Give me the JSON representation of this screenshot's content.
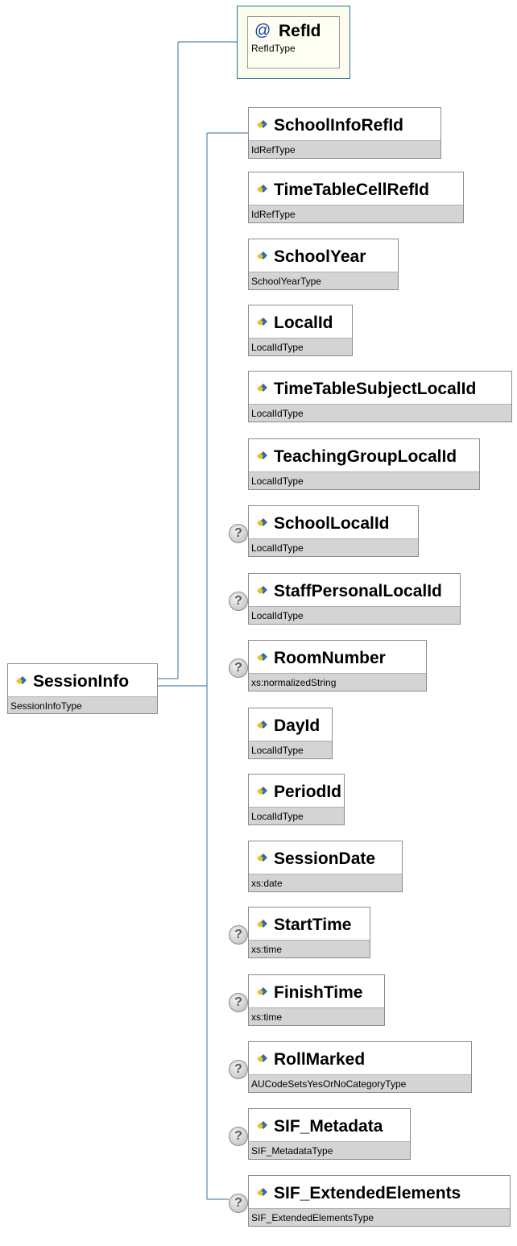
{
  "root": {
    "name": "SessionInfo",
    "type": "SessionInfoType"
  },
  "attribute": {
    "symbol": "@",
    "name": "RefId",
    "type": "RefIdType"
  },
  "children": [
    {
      "name": "SchoolInfoRefId",
      "type": "IdRefType",
      "optional": false
    },
    {
      "name": "TimeTableCellRefId",
      "type": "IdRefType",
      "optional": false
    },
    {
      "name": "SchoolYear",
      "type": "SchoolYearType",
      "optional": false
    },
    {
      "name": "LocalId",
      "type": "LocalIdType",
      "optional": false
    },
    {
      "name": "TimeTableSubjectLocalId",
      "type": "LocalIdType",
      "optional": false
    },
    {
      "name": "TeachingGroupLocalId",
      "type": "LocalIdType",
      "optional": false
    },
    {
      "name": "SchoolLocalId",
      "type": "LocalIdType",
      "optional": true
    },
    {
      "name": "StaffPersonalLocalId",
      "type": "LocalIdType",
      "optional": true
    },
    {
      "name": "RoomNumber",
      "type": "xs:normalizedString",
      "optional": true
    },
    {
      "name": "DayId",
      "type": "LocalIdType",
      "optional": false
    },
    {
      "name": "PeriodId",
      "type": "LocalIdType",
      "optional": false
    },
    {
      "name": "SessionDate",
      "type": "xs:date",
      "optional": false
    },
    {
      "name": "StartTime",
      "type": "xs:time",
      "optional": true
    },
    {
      "name": "FinishTime",
      "type": "xs:time",
      "optional": true
    },
    {
      "name": "RollMarked",
      "type": "AUCodeSetsYesOrNoCategoryType",
      "optional": true
    },
    {
      "name": "SIF_Metadata",
      "type": "SIF_MetadataType",
      "optional": true
    },
    {
      "name": "SIF_ExtendedElements",
      "type": "SIF_ExtendedElementsType",
      "optional": true
    }
  ],
  "optional_marker": "?",
  "colors": {
    "connector": "#2f6fa0",
    "icon_blue": "#2f6fa8",
    "icon_yellow": "#f0c020"
  }
}
